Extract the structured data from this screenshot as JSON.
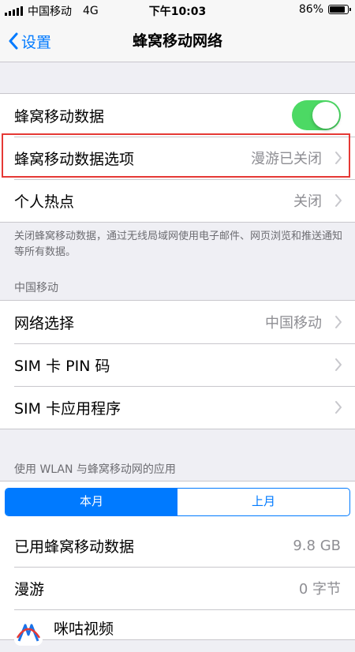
{
  "status_bar": {
    "carrier": "中国移动",
    "network": "4G",
    "time": "下午10:03",
    "battery": "86%"
  },
  "nav": {
    "back_label": "设置",
    "title": "蜂窝移动网络"
  },
  "cellular_group": {
    "cellular_data_label": "蜂窝移动数据",
    "cellular_data_on": true,
    "options_label": "蜂窝移动数据选项",
    "options_value": "漫游已关闭",
    "hotspot_label": "个人热点",
    "hotspot_value": "关闭"
  },
  "cellular_footnote": "关闭蜂窝移动数据，通过无线局域网使用电子邮件、网页浏览和推送通知等所有数据。",
  "carrier_section": {
    "header": "中国移动",
    "network_select_label": "网络选择",
    "network_select_value": "中国移动",
    "sim_pin_label": "SIM 卡 PIN 码",
    "sim_apps_label": "SIM 卡应用程序"
  },
  "usage_section": {
    "header": "使用 WLAN 与蜂窝移动网的应用",
    "tabs": [
      "本月",
      "上月"
    ],
    "active_tab": 0,
    "used_label": "已用蜂窝移动数据",
    "used_value": "9.8 GB",
    "roaming_label": "漫游",
    "roaming_value": "0 字节",
    "app_name": "咪咕视频"
  },
  "colors": {
    "accent": "#007aff",
    "toggle_on": "#4cd964",
    "highlight": "#e53935"
  }
}
